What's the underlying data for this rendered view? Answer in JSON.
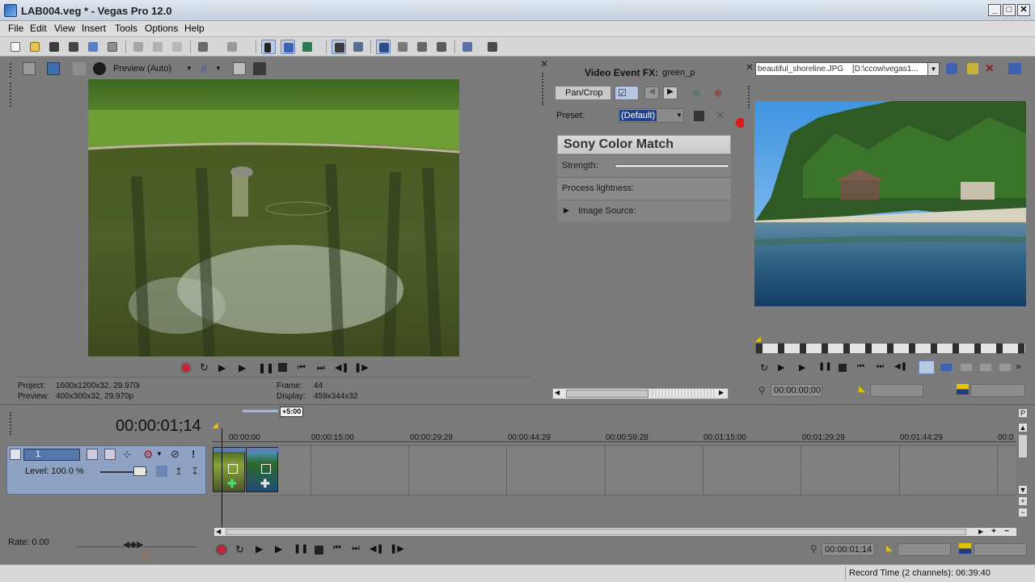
{
  "window": {
    "title": "LAB004.veg * - Vegas Pro 12.0",
    "minimize": "_",
    "maximize": "□",
    "close": "✕"
  },
  "menu": [
    "File",
    "Edit",
    "View",
    "Insert",
    "Tools",
    "Options",
    "Help"
  ],
  "preview": {
    "quality_label": "Preview (Auto)",
    "project_label": "Project:",
    "project_value": "1600x1200x32, 29.970i",
    "preview_label": "Preview:",
    "preview_value": "400x300x32, 29.970p",
    "frame_label": "Frame:",
    "frame_value": "44",
    "display_label": "Display:",
    "display_value": "459x344x32"
  },
  "fx": {
    "title": "Video Event FX:",
    "event_name": "green_p",
    "chain_tab": "Pan/Crop",
    "preset_label": "Preset:",
    "preset_value": "(Default)",
    "plugin_name": "Sony Color Match",
    "param_strength": "Strength:",
    "param_process": "Process lightness:",
    "param_image_source": "Image Source:"
  },
  "trimmer": {
    "file_name": "beautiful_shoreline.JPG",
    "file_path": "[D:\\ccow\\vegas1...",
    "timecode": "00:00:00;00"
  },
  "timeline": {
    "cursor_time": "00:00:01;14",
    "zoom_badge": "+5:00",
    "ruler_labels": [
      "00:00:00",
      "00:00:15:00",
      "00:00:29:29",
      "00:00:44:29",
      "00:00:59:28",
      "00:01:15:00",
      "00:01:29:29",
      "00:01:44:29",
      "00:0"
    ],
    "track_number": "1",
    "track_level": "Level: 100.0 %",
    "rate": "Rate: 0.00",
    "transport_time": "00:00:01;14"
  },
  "status": {
    "record_time": "Record Time (2 channels): 06:39:40"
  }
}
